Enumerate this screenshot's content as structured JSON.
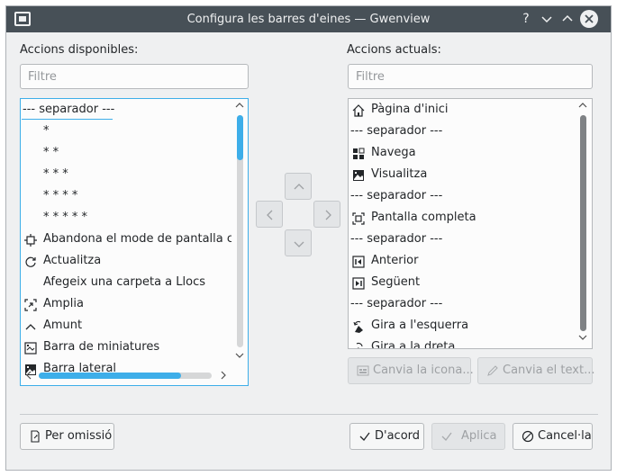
{
  "window": {
    "title": "Configura les barres d'eines — Gwenview"
  },
  "titlebar": {
    "help": "?",
    "minimize": "⌄",
    "maximize": "⌃"
  },
  "left": {
    "label": "Accions disponibles:",
    "filter_placeholder": "Filtre",
    "items": [
      {
        "icon": "",
        "text": "--- separador ---",
        "separator": true
      },
      {
        "icon": "",
        "text": "*"
      },
      {
        "icon": "",
        "text": "* *"
      },
      {
        "icon": "",
        "text": "* * *"
      },
      {
        "icon": "",
        "text": "* * * *"
      },
      {
        "icon": "",
        "text": "* * * * *"
      },
      {
        "icon": "fullscreen-exit-icon",
        "text": "Abandona el mode de pantalla completa"
      },
      {
        "icon": "refresh-icon",
        "text": "Actualitza"
      },
      {
        "icon": "",
        "text": "Afegeix una carpeta a Llocs"
      },
      {
        "icon": "zoom-in-icon",
        "text": "Amplia"
      },
      {
        "icon": "chevron-up-icon",
        "text": "Amunt"
      },
      {
        "icon": "thumbnail-bar-icon",
        "text": "Barra de miniatures"
      },
      {
        "icon": "image-icon",
        "text": "Barra lateral"
      }
    ]
  },
  "right": {
    "label": "Accions actuals:",
    "filter_placeholder": "Filtre",
    "items": [
      {
        "icon": "home-icon",
        "text": "Pàgina d'inici"
      },
      {
        "icon": "",
        "text": "--- separador ---",
        "separator": true
      },
      {
        "icon": "grid-icon",
        "text": "Navega"
      },
      {
        "icon": "image-icon",
        "text": "Visualitza"
      },
      {
        "icon": "",
        "text": "--- separador ---",
        "separator": true
      },
      {
        "icon": "fullscreen-icon",
        "text": "Pantalla completa"
      },
      {
        "icon": "",
        "text": "--- separador ---",
        "separator": true
      },
      {
        "icon": "previous-icon",
        "text": "Anterior"
      },
      {
        "icon": "next-icon",
        "text": "Següent"
      },
      {
        "icon": "",
        "text": "--- separador ---",
        "separator": true
      },
      {
        "icon": "rotate-left-icon",
        "text": "Gira a l'esquerra"
      },
      {
        "icon": "rotate-right-icon",
        "text": "Gira a la dreta"
      }
    ],
    "change_icon": "Canvia la icona...",
    "change_text": "Canvia el text..."
  },
  "footer": {
    "defaults": "Per omissió",
    "ok": "D'acord",
    "apply": "Aplica",
    "cancel": "Cancel·la"
  },
  "colors": {
    "accent": "#3daee9",
    "titlebar": "#475057",
    "scroll_thumb_right": "#7f8285"
  },
  "scroll": {
    "left_vertical_position": 0,
    "left_horizontal_fraction": 0.85,
    "right_vertical_position": 0
  }
}
